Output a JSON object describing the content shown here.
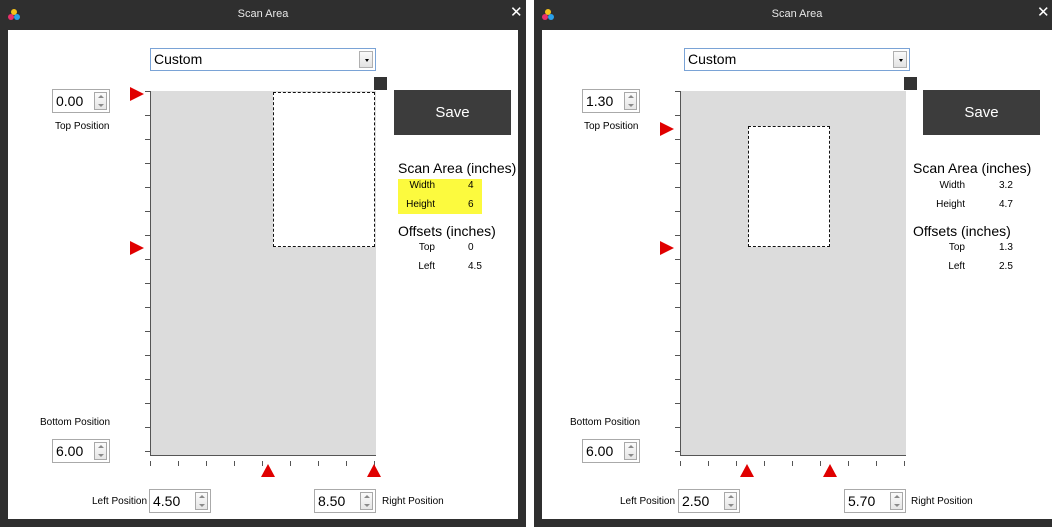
{
  "dialogs": [
    {
      "title": "Scan Area",
      "close_glyph": "✕",
      "app_icon": "color-dots-icon",
      "preset": "Custom",
      "top_position": {
        "label": "Top Position",
        "value": "0.00"
      },
      "bottom_position": {
        "label": "Bottom Position",
        "value": "6.00"
      },
      "left_position": {
        "label": "Left Position",
        "value": "4.50"
      },
      "right_position": {
        "label": "Right Position",
        "value": "8.50"
      },
      "save_label": "Save",
      "scan_area": {
        "heading": "Scan Area (inches)",
        "width_label": "Width",
        "width": "4",
        "height_label": "Height",
        "height": "6",
        "highlight": "#fcfa3e"
      },
      "offsets": {
        "heading": "Offsets (inches)",
        "top_label": "Top",
        "top": "0",
        "left_label": "Left",
        "left": "4.5"
      }
    },
    {
      "title": "Scan Area",
      "close_glyph": "✕",
      "app_icon": "color-dots-icon",
      "preset": "Custom",
      "top_position": {
        "label": "Top Position",
        "value": "1.30"
      },
      "bottom_position": {
        "label": "Bottom Position",
        "value": "6.00"
      },
      "left_position": {
        "label": "Left Position",
        "value": "2.50"
      },
      "right_position": {
        "label": "Right Position",
        "value": "5.70"
      },
      "save_label": "Save",
      "scan_area": {
        "heading": "Scan Area (inches)",
        "width_label": "Width",
        "width": "3.2",
        "height_label": "Height",
        "height": "4.7"
      },
      "offsets": {
        "heading": "Offsets (inches)",
        "top_label": "Top",
        "top": "1.3",
        "left_label": "Left",
        "left": "2.5"
      }
    }
  ],
  "colors": {
    "marker": "#e00000",
    "titlebar": "#2f2f2f",
    "button": "#3c3c3c"
  }
}
